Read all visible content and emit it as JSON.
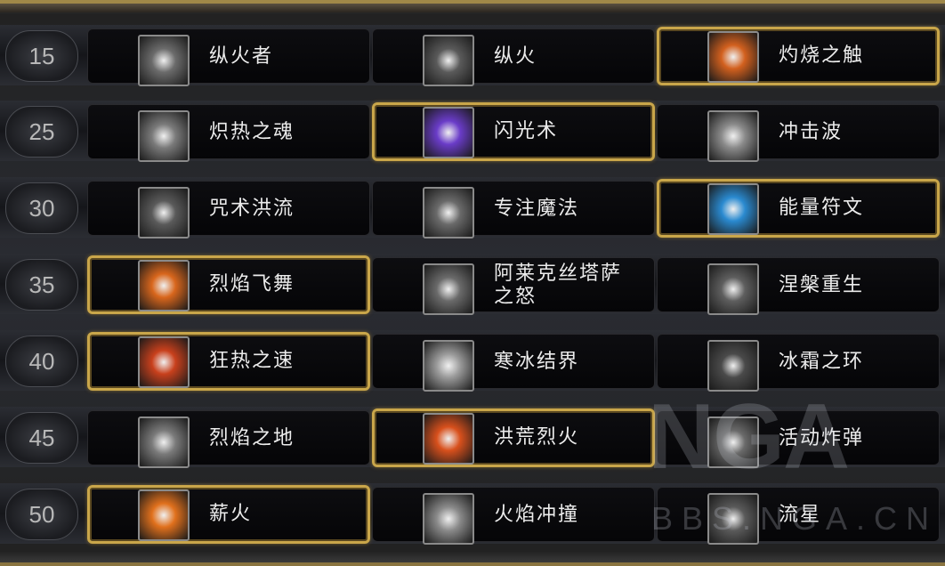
{
  "rows": [
    {
      "level": "15",
      "talents": [
        {
          "name": "纵火者",
          "icon": "fire-spirit-icon",
          "selected": false,
          "bg": "#6b6b6b"
        },
        {
          "name": "纵火",
          "icon": "smoke-icon",
          "selected": false,
          "bg": "#5a5a5a"
        },
        {
          "name": "灼烧之触",
          "icon": "scorch-touch-icon",
          "selected": true,
          "bg": "#d2601e"
        }
      ]
    },
    {
      "level": "25",
      "talents": [
        {
          "name": "炽热之魂",
          "icon": "blazing-soul-icon",
          "selected": false,
          "bg": "#7a7a7a"
        },
        {
          "name": "闪光术",
          "icon": "shimmer-icon",
          "selected": true,
          "bg": "#6a3cc8"
        },
        {
          "name": "冲击波",
          "icon": "blast-wave-icon",
          "selected": false,
          "bg": "#8a8a8a"
        }
      ]
    },
    {
      "level": "30",
      "talents": [
        {
          "name": "咒术洪流",
          "icon": "incanters-flow-icon",
          "selected": false,
          "bg": "#5a5a5a"
        },
        {
          "name": "专注魔法",
          "icon": "focus-magic-icon",
          "selected": false,
          "bg": "#6a6a6a"
        },
        {
          "name": "能量符文",
          "icon": "rune-of-power-icon",
          "selected": true,
          "bg": "#2a8ad0"
        }
      ]
    },
    {
      "level": "35",
      "talents": [
        {
          "name": "烈焰飞舞",
          "icon": "flame-on-icon",
          "selected": true,
          "bg": "#d8661c"
        },
        {
          "name": "阿莱克丝塔萨之怒",
          "icon": "alexstrasza-fury-icon",
          "selected": false,
          "bg": "#6a6a6a"
        },
        {
          "name": "涅槃重生",
          "icon": "from-the-ashes-icon",
          "selected": false,
          "bg": "#5e5e5e"
        }
      ]
    },
    {
      "level": "40",
      "talents": [
        {
          "name": "狂热之速",
          "icon": "frenetic-speed-icon",
          "selected": true,
          "bg": "#c8401c"
        },
        {
          "name": "寒冰结界",
          "icon": "ice-ward-icon",
          "selected": false,
          "bg": "#9a9a9a"
        },
        {
          "name": "冰霜之环",
          "icon": "ring-of-frost-icon",
          "selected": false,
          "bg": "#4a4a4a"
        }
      ]
    },
    {
      "level": "45",
      "talents": [
        {
          "name": "烈焰之地",
          "icon": "flame-patch-icon",
          "selected": false,
          "bg": "#7a7a7a"
        },
        {
          "name": "洪荒烈火",
          "icon": "conflagration-icon",
          "selected": true,
          "bg": "#d8501c"
        },
        {
          "name": "活动炸弹",
          "icon": "living-bomb-icon",
          "selected": false,
          "bg": "#6a6a6a"
        }
      ]
    },
    {
      "level": "50",
      "talents": [
        {
          "name": "薪火",
          "icon": "kindling-icon",
          "selected": true,
          "bg": "#e0701c"
        },
        {
          "name": "火焰冲撞",
          "icon": "pyroclasm-icon",
          "selected": false,
          "bg": "#8a8a8a"
        },
        {
          "name": "流星",
          "icon": "meteor-icon",
          "selected": false,
          "bg": "#5a5a5a"
        }
      ]
    }
  ],
  "watermark": {
    "logo": "NGA",
    "site": "BBS.NGA.CN"
  }
}
